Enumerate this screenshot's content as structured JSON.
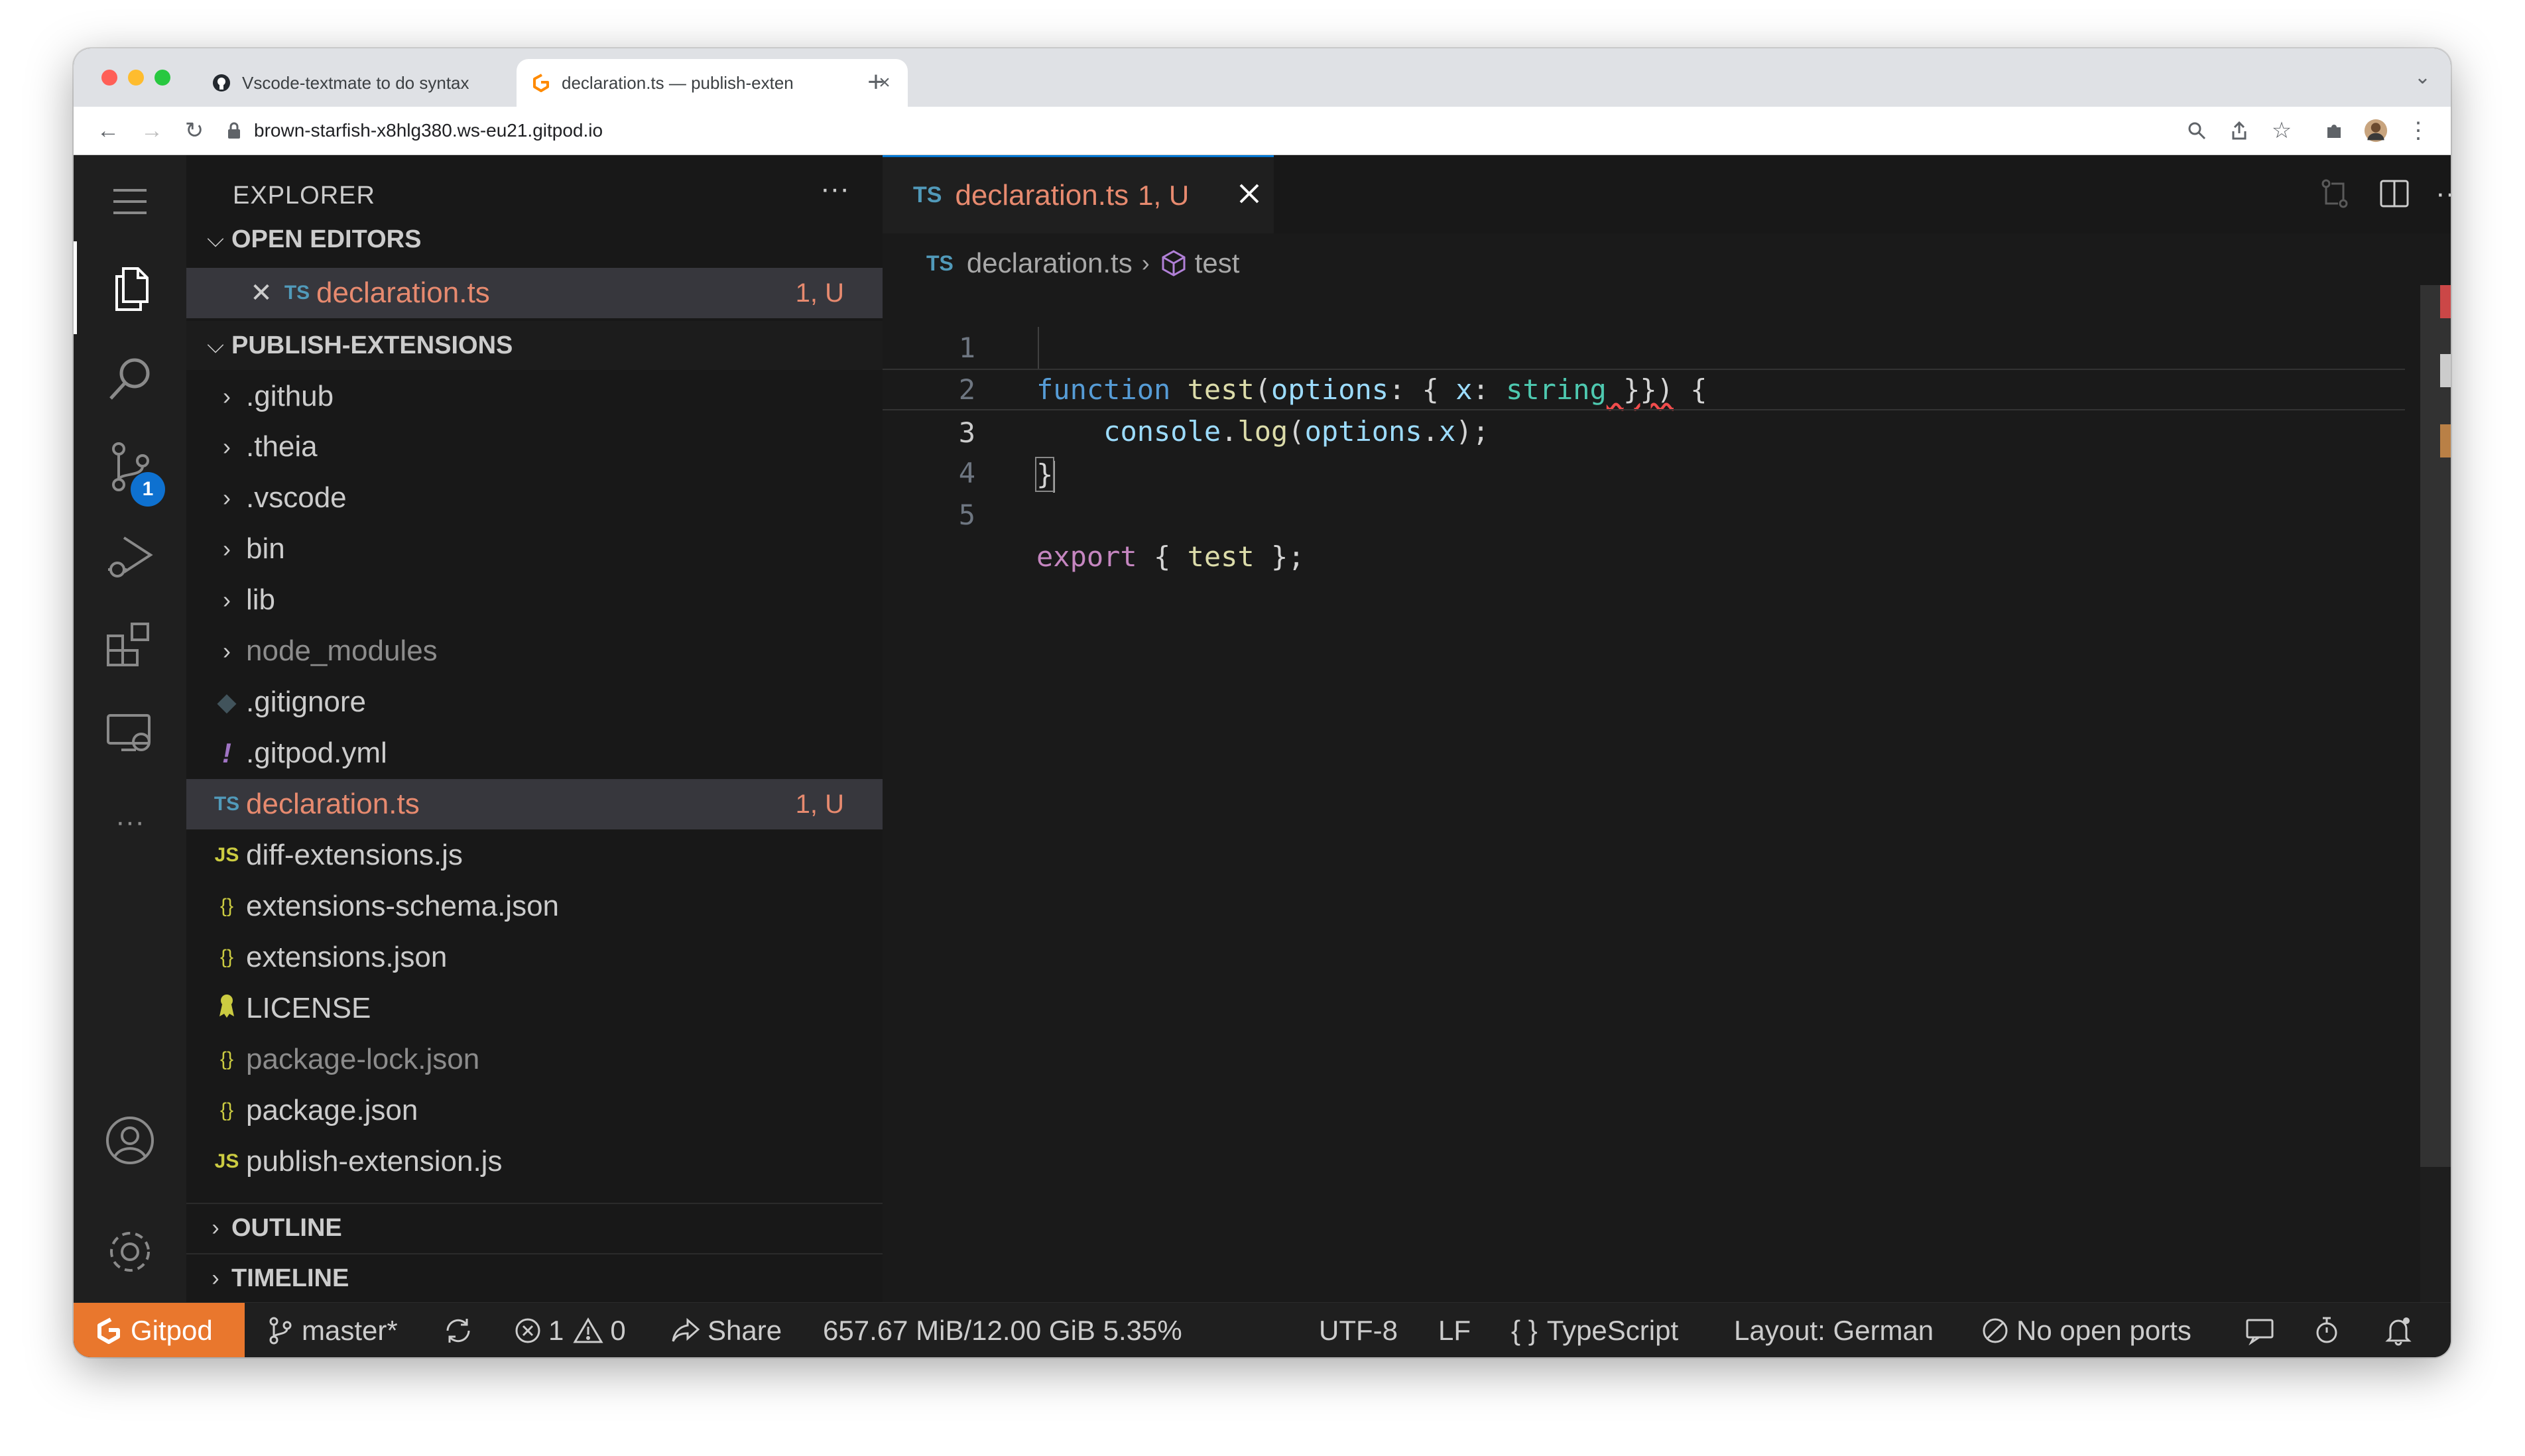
{
  "browser": {
    "tabs": [
      {
        "title": "Vscode-textmate to do syntax",
        "active": false
      },
      {
        "title": "declaration.ts — publish-exten",
        "active": true
      }
    ],
    "url": "brown-starfish-x8hlg380.ws-eu21.gitpod.io"
  },
  "explorer": {
    "title": "EXPLORER",
    "open_editors": {
      "label": "OPEN EDITORS",
      "items": [
        {
          "icon": "TS",
          "name": "declaration.ts",
          "status": "1, U"
        }
      ]
    },
    "workspace": {
      "label": "PUBLISH-EXTENSIONS",
      "items": [
        {
          "icon": "chevron",
          "name": ".github"
        },
        {
          "icon": "chevron",
          "name": ".theia"
        },
        {
          "icon": "chevron",
          "name": ".vscode"
        },
        {
          "icon": "chevron",
          "name": "bin"
        },
        {
          "icon": "chevron",
          "name": "lib"
        },
        {
          "icon": "chevron",
          "name": "node_modules"
        },
        {
          "icon": "◆",
          "name": ".gitignore"
        },
        {
          "icon": "!",
          "name": ".gitpod.yml"
        },
        {
          "icon": "TS",
          "name": "declaration.ts",
          "status": "1, U"
        },
        {
          "icon": "JS",
          "name": "diff-extensions.js"
        },
        {
          "icon": "{}",
          "name": "extensions-schema.json"
        },
        {
          "icon": "{}",
          "name": "extensions.json"
        },
        {
          "icon": "license-icon",
          "name": "LICENSE"
        },
        {
          "icon": "{}",
          "name": "package-lock.json"
        },
        {
          "icon": "{}",
          "name": "package.json"
        },
        {
          "icon": "JS",
          "name": "publish-extension.js"
        }
      ]
    },
    "outline_label": "OUTLINE",
    "timeline_label": "TIMELINE"
  },
  "activity_bar": {
    "scm_badge": "1"
  },
  "editor": {
    "tab": {
      "lang": "TS",
      "name": "declaration.ts",
      "status": "1, U"
    },
    "breadcrumb": {
      "file_lang": "TS",
      "file": "declaration.ts",
      "symbol": "test"
    },
    "line_numbers": [
      "1",
      "2",
      "3",
      "4",
      "5"
    ],
    "code": {
      "l1": {
        "kw": "function",
        "fn": "test",
        "p1": "(",
        "param": "options",
        "p2": ": { ",
        "prop": "x",
        "p3": ": ",
        "type": "string",
        "p4": " }})",
        "p5": " {"
      },
      "l2": {
        "indent": "    ",
        "obj": "console",
        "dot": ".",
        "method": "log",
        "p1": "(",
        "arg": "options",
        "dot2": ".",
        "prop": "x",
        "p2": ");"
      },
      "l3": {
        "brace": "}"
      },
      "l5": {
        "kw": "export",
        "p1": " { ",
        "name": "test",
        "p2": " };"
      }
    }
  },
  "status_bar": {
    "gitpod": "Gitpod",
    "branch": "master*",
    "errors": "1",
    "warnings": "0",
    "share": "Share",
    "memory": "657.67 MiB/12.00 GiB 5.35%",
    "encoding": "UTF-8",
    "eol": "LF",
    "language": "TypeScript",
    "layout": "Layout: German",
    "ports": "No open ports"
  }
}
